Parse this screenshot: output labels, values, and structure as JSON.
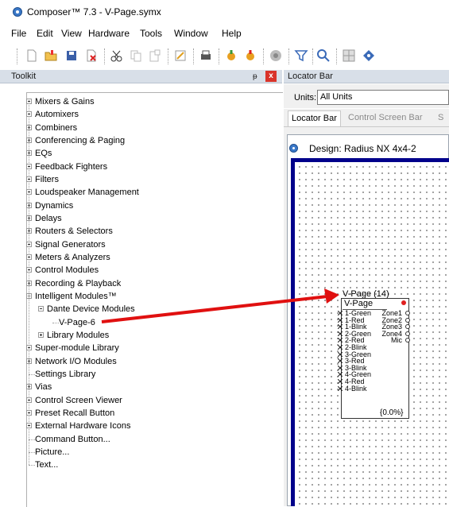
{
  "window": {
    "title": "Composer™ 7.3 - V-Page.symx"
  },
  "menu": [
    "File",
    "Edit",
    "View",
    "Hardware",
    "Tools",
    "Window",
    "Help"
  ],
  "toolbar_icons": [
    "new-file-icon",
    "open-folder-icon",
    "save-icon",
    "delete-icon",
    "cut-icon",
    "copy-icon",
    "paste-icon",
    "edit-icon",
    "print-icon",
    "compile-icon",
    "send-icon",
    "connect-icon",
    "filter-icon",
    "find-icon",
    "grid-icon",
    "help-icon"
  ],
  "toolkit": {
    "title": "Toolkit",
    "pin_glyph": "ᵽ",
    "close_glyph": "x",
    "items": [
      {
        "label": "Mixers & Gains",
        "level": 0,
        "expander": "plus"
      },
      {
        "label": "Automixers",
        "level": 0,
        "expander": "plus"
      },
      {
        "label": "Combiners",
        "level": 0,
        "expander": "plus"
      },
      {
        "label": "Conferencing & Paging",
        "level": 0,
        "expander": "plus"
      },
      {
        "label": "EQs",
        "level": 0,
        "expander": "plus"
      },
      {
        "label": "Feedback Fighters",
        "level": 0,
        "expander": "plus"
      },
      {
        "label": "Filters",
        "level": 0,
        "expander": "plus"
      },
      {
        "label": "Loudspeaker Management",
        "level": 0,
        "expander": "plus"
      },
      {
        "label": "Dynamics",
        "level": 0,
        "expander": "plus"
      },
      {
        "label": "Delays",
        "level": 0,
        "expander": "plus"
      },
      {
        "label": "Routers & Selectors",
        "level": 0,
        "expander": "plus"
      },
      {
        "label": "Signal Generators",
        "level": 0,
        "expander": "plus"
      },
      {
        "label": "Meters & Analyzers",
        "level": 0,
        "expander": "plus"
      },
      {
        "label": "Control Modules",
        "level": 0,
        "expander": "plus"
      },
      {
        "label": "Recording & Playback",
        "level": 0,
        "expander": "plus"
      },
      {
        "label": "Intelligent Modules™",
        "level": 0,
        "expander": "minus"
      },
      {
        "label": "Dante Device Modules",
        "level": 1,
        "expander": "minus"
      },
      {
        "label": "V-Page-6",
        "level": 2,
        "expander": "none"
      },
      {
        "label": "Library Modules",
        "level": 1,
        "expander": "plus"
      },
      {
        "label": "Super-module Library",
        "level": 0,
        "expander": "plus"
      },
      {
        "label": "Network I/O Modules",
        "level": 0,
        "expander": "plus"
      },
      {
        "label": "Settings Library",
        "level": 0,
        "expander": "none"
      },
      {
        "label": "Vias",
        "level": 0,
        "expander": "plus"
      },
      {
        "label": "Control Screen Viewer",
        "level": 0,
        "expander": "plus"
      },
      {
        "label": "Preset Recall Button",
        "level": 0,
        "expander": "plus"
      },
      {
        "label": "External Hardware Icons",
        "level": 0,
        "expander": "plus"
      },
      {
        "label": "Command Button...",
        "level": 0,
        "expander": "none"
      },
      {
        "label": "Picture...",
        "level": 0,
        "expander": "none"
      },
      {
        "label": "Text...",
        "level": 0,
        "expander": "none"
      }
    ]
  },
  "locator": {
    "title": "Locator Bar",
    "units_label": "Units:",
    "units_value": "All Units",
    "tabs": [
      "Locator Bar",
      "Control Screen Bar",
      "S"
    ]
  },
  "design": {
    "title": "Design: Radius NX 4x4-2",
    "module": {
      "title": "V-Page (14)",
      "name": "V-Page",
      "inputs": [
        "1-Green",
        "1-Red",
        "1-Blink",
        "2-Green",
        "2-Red",
        "2-Blink",
        "3-Green",
        "3-Red",
        "3-Blink",
        "4-Green",
        "4-Red",
        "4-Blink"
      ],
      "outputs": [
        "Zone1",
        "Zone2",
        "Zone3",
        "Zone4",
        "Mic"
      ],
      "status": "{0.0%}"
    }
  },
  "annotation": {
    "arrow_color": "#e01010"
  }
}
